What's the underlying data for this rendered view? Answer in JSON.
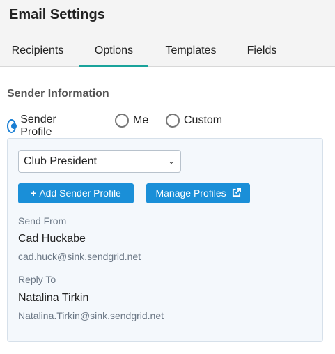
{
  "header": {
    "title": "Email Settings",
    "tabs": [
      {
        "label": "Recipients",
        "active": false
      },
      {
        "label": "Options",
        "active": true
      },
      {
        "label": "Templates",
        "active": false
      },
      {
        "label": "Fields",
        "active": false
      }
    ]
  },
  "sender": {
    "section_label": "Sender Information",
    "radios": [
      {
        "label": "Sender Profile",
        "checked": true
      },
      {
        "label": "Me",
        "checked": false
      },
      {
        "label": "Custom",
        "checked": false
      }
    ],
    "profile_select": {
      "value": "Club President"
    },
    "add_button": {
      "label": "Add Sender Profile",
      "icon": "plus-icon"
    },
    "manage_button": {
      "label": "Manage Profiles",
      "icon": "external-link-icon"
    },
    "send_from": {
      "label": "Send From",
      "name": "Cad Huckabe",
      "email": "cad.huck@sink.sendgrid.net"
    },
    "reply_to": {
      "label": "Reply To",
      "name": "Natalina Tirkin",
      "email": "Natalina.Tirkin@sink.sendgrid.net"
    }
  },
  "colors": {
    "accent_tab": "#1aa39b",
    "button": "#1a8fd8",
    "radio": "#1a7fd4"
  }
}
